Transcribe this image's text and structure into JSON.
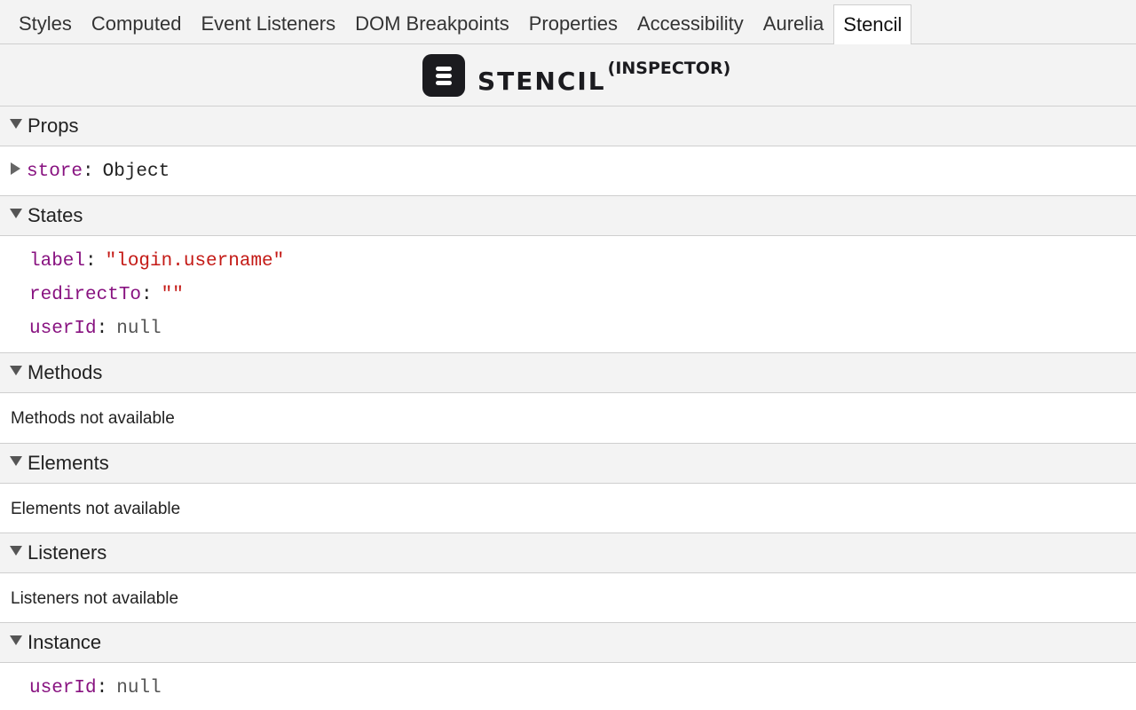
{
  "tabs": [
    {
      "label": "Styles"
    },
    {
      "label": "Computed"
    },
    {
      "label": "Event Listeners"
    },
    {
      "label": "DOM Breakpoints"
    },
    {
      "label": "Properties"
    },
    {
      "label": "Accessibility"
    },
    {
      "label": "Aurelia"
    },
    {
      "label": "Stencil",
      "active": true
    }
  ],
  "logo": {
    "text": "STENCIL",
    "superscript": "(INSPECTOR)",
    "icon": "stencil-logo-icon"
  },
  "sections": {
    "props": {
      "title": "Props",
      "items": [
        {
          "key": "store",
          "colon": ":",
          "value": "Object",
          "type": "object",
          "expandable": true
        }
      ]
    },
    "states": {
      "title": "States",
      "items": [
        {
          "key": "label",
          "colon": ":",
          "value": "\"login.username\"",
          "type": "string"
        },
        {
          "key": "redirectTo",
          "colon": ":",
          "value": "\"\"",
          "type": "string"
        },
        {
          "key": "userId",
          "colon": ":",
          "value": "null",
          "type": "null"
        }
      ]
    },
    "methods": {
      "title": "Methods",
      "empty_message": "Methods not available"
    },
    "elements": {
      "title": "Elements",
      "empty_message": "Elements not available"
    },
    "listeners": {
      "title": "Listeners",
      "empty_message": "Listeners not available"
    },
    "instance": {
      "title": "Instance",
      "items": [
        {
          "key": "userId",
          "colon": ":",
          "value": "null",
          "type": "null"
        }
      ]
    }
  },
  "colors": {
    "key": "#881280",
    "string": "#c41a16",
    "null": "#545454",
    "header_bg": "#f3f3f3",
    "border": "#cfcfcf"
  }
}
